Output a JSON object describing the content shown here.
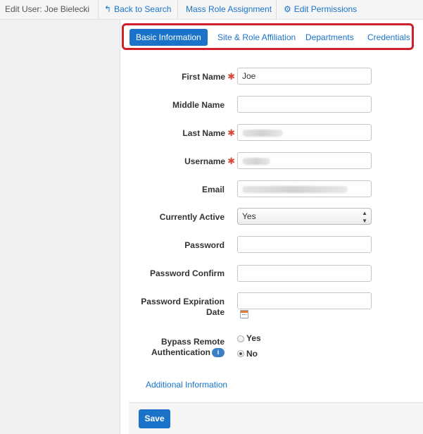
{
  "topbar": {
    "title": "Edit User: Joe Bielecki",
    "back_link": "Back to Search",
    "mass_role": "Mass Role Assignment",
    "edit_permissions": "Edit Permissions"
  },
  "tabs": [
    {
      "label": "Basic Information",
      "active": true
    },
    {
      "label": "Site & Role Affiliation",
      "active": false
    },
    {
      "label": "Departments",
      "active": false
    },
    {
      "label": "Credentials",
      "active": false
    }
  ],
  "form": {
    "first_name": {
      "label": "First Name",
      "value": "Joe",
      "required": true
    },
    "middle_name": {
      "label": "Middle Name",
      "value": ""
    },
    "last_name": {
      "label": "Last Name",
      "required": true
    },
    "username": {
      "label": "Username",
      "required": true
    },
    "email": {
      "label": "Email"
    },
    "active": {
      "label": "Currently Active",
      "value": "Yes"
    },
    "password": {
      "label": "Password",
      "value": ""
    },
    "password_confirm": {
      "label": "Password Confirm",
      "value": ""
    },
    "password_expiration": {
      "label_line1": "Password Expiration",
      "label_line2": "Date",
      "value": ""
    },
    "bypass": {
      "label_line1": "Bypass Remote",
      "label_line2": "Authentication",
      "options": [
        {
          "label": "Yes",
          "checked": false
        },
        {
          "label": "No",
          "checked": true
        }
      ]
    },
    "required_marker": "✱",
    "info_glyph": "i"
  },
  "additional_info_link": "Additional Information",
  "save_label": "Save",
  "colors": {
    "accent": "#1a73c9",
    "highlight_border": "#d0202a",
    "required": "#d9463b"
  }
}
